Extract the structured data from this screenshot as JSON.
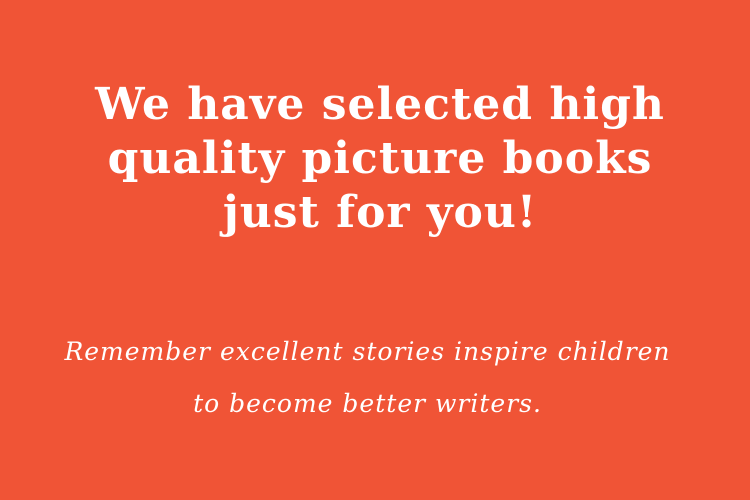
{
  "background_color": "#f05436",
  "text_color": "#ffffff",
  "headline": {
    "lines": [
      "We have selected high",
      "quality picture books",
      "just for you!"
    ]
  },
  "subline": {
    "lines": [
      "Remember excellent stories inspire children",
      "to become better writers."
    ]
  }
}
